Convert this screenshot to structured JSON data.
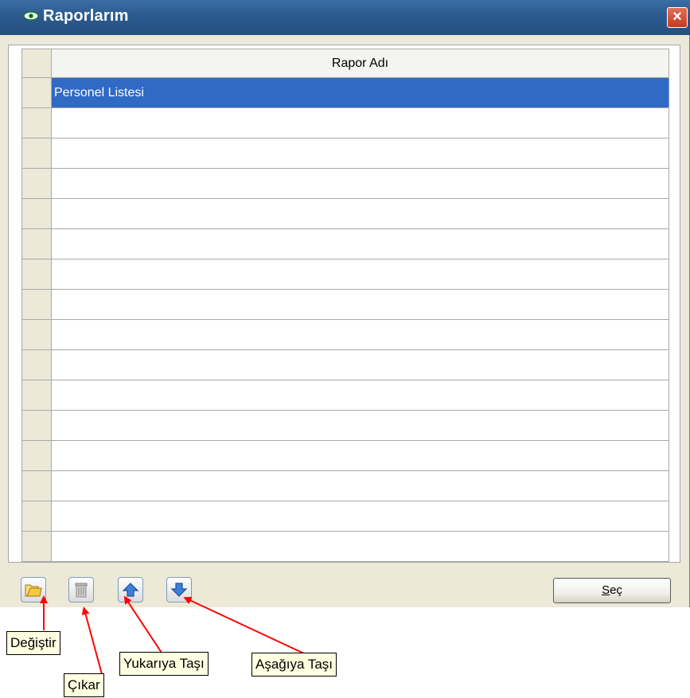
{
  "window": {
    "title": "Raporlarım",
    "close_glyph": "×",
    "title_icon": "eye-icon"
  },
  "grid": {
    "column_header": "Rapor Adı",
    "rows": [
      "Personel Listesi",
      "",
      "",
      "",
      "",
      "",
      "",
      "",
      "",
      "",
      "",
      "",
      "",
      "",
      "",
      ""
    ],
    "selected_row": 0,
    "selection_color": "#316ac5"
  },
  "toolbar": {
    "buttons": [
      {
        "icon": "folder-open-icon"
      },
      {
        "icon": "trash-icon"
      },
      {
        "icon": "arrow-up-icon"
      },
      {
        "icon": "arrow-down-icon"
      }
    ],
    "select_label_accel": "S",
    "select_label_rest": "eç"
  },
  "callouts": {
    "edit": "Değiştir",
    "remove": "Çıkar",
    "move_up": "Yukarıya Taşı",
    "move_down": "Aşağıya Taşı",
    "arrow_color": "#ff0000"
  }
}
